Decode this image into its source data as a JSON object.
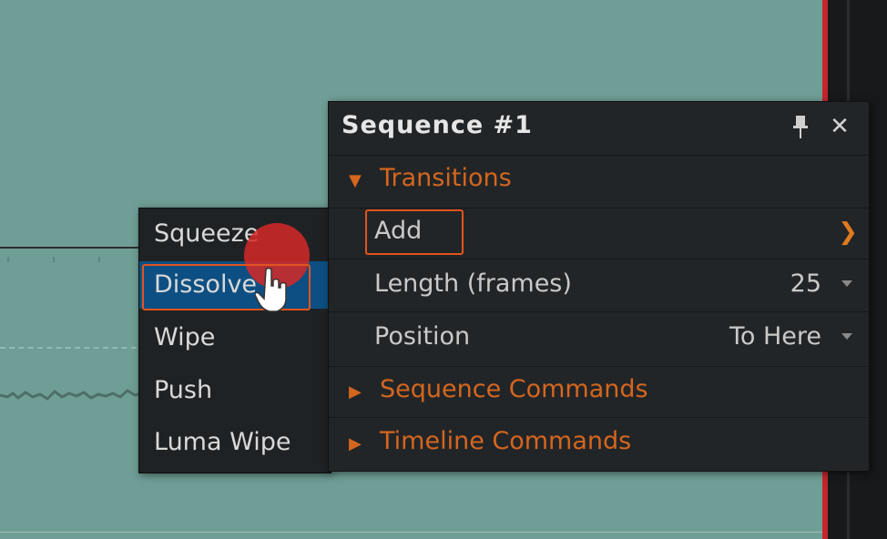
{
  "submenu": {
    "items": [
      {
        "label": "Squeeze"
      },
      {
        "label": "Dissolve",
        "selected": true
      },
      {
        "label": "Wipe"
      },
      {
        "label": "Push"
      },
      {
        "label": "Luma Wipe"
      }
    ]
  },
  "panel": {
    "title": "Sequence #1",
    "sections": {
      "transitions": {
        "label": "Transitions",
        "expanded": true
      },
      "sequence_commands": {
        "label": "Sequence Commands",
        "expanded": false
      },
      "timeline_commands": {
        "label": "Timeline Commands",
        "expanded": false
      }
    },
    "add": {
      "label": "Add"
    },
    "length": {
      "label": "Length (frames)",
      "value": "25"
    },
    "position": {
      "label": "Position",
      "value": "To Here"
    }
  },
  "colors": {
    "accent": "#d4661f",
    "timeline_bg": "#6f9e96",
    "selection": "#0d4f82",
    "highlight": "#e2541d"
  },
  "icons": [
    "pin-icon",
    "close-icon",
    "triangle-down-icon",
    "triangle-right-icon",
    "chevron-right-icon",
    "dropdown-icon",
    "hand-cursor-icon"
  ]
}
